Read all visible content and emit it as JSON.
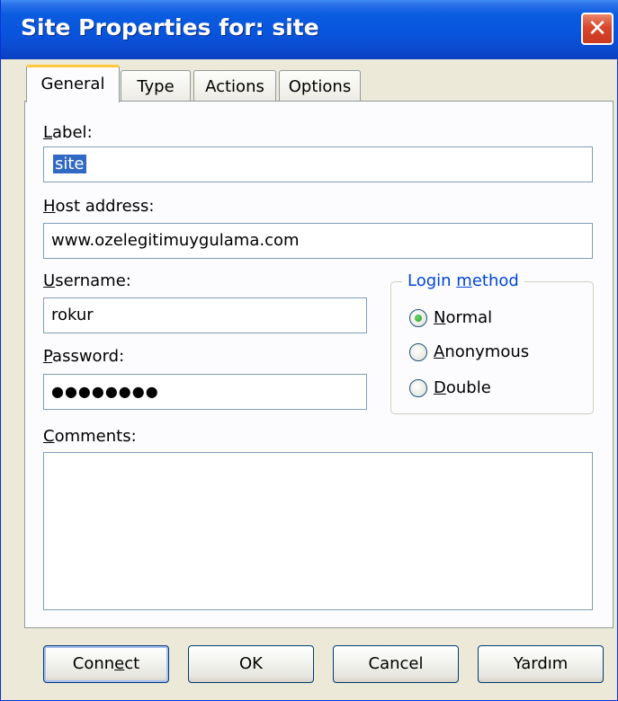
{
  "window": {
    "title": "Site Properties for: site",
    "close_symbol": "✕"
  },
  "tabs": [
    {
      "label": "General",
      "active": true
    },
    {
      "label": "Type",
      "active": false
    },
    {
      "label": "Actions",
      "active": false
    },
    {
      "label": "Options",
      "active": false
    }
  ],
  "form": {
    "label_field": {
      "caption_mnemonic": "L",
      "caption_rest": "abel:",
      "value": "site"
    },
    "host_field": {
      "caption_mnemonic": "H",
      "caption_rest": "ost address:",
      "value": "www.ozelegitimuygulama.com"
    },
    "username_field": {
      "caption_mnemonic": "U",
      "caption_rest": "sername:",
      "value": "rokur"
    },
    "password_field": {
      "caption_mnemonic": "P",
      "caption_rest": "assword:",
      "value": "●●●●●●●●"
    },
    "comments_field": {
      "caption_mnemonic": "C",
      "caption_rest": "omments:",
      "value": ""
    }
  },
  "login_method": {
    "legend_pre": "Login ",
    "legend_mnemonic": "m",
    "legend_post": "ethod",
    "options": [
      {
        "mnemonic": "N",
        "rest": "ormal",
        "selected": true
      },
      {
        "mnemonic": "A",
        "rest": "nonymous",
        "selected": false
      },
      {
        "mnemonic": "D",
        "rest": "ouble",
        "selected": false
      }
    ]
  },
  "buttons": {
    "connect": {
      "pre": "Conn",
      "mnemonic": "e",
      "post": "ct"
    },
    "ok": "OK",
    "cancel": "Cancel",
    "help": "Yardım"
  },
  "colors": {
    "titlebar": "#0855dd",
    "face": "#ece9d8",
    "selection": "#316ac5",
    "active_tab_accent": "#ffc83c",
    "groupbox_legend": "#0046d5"
  }
}
